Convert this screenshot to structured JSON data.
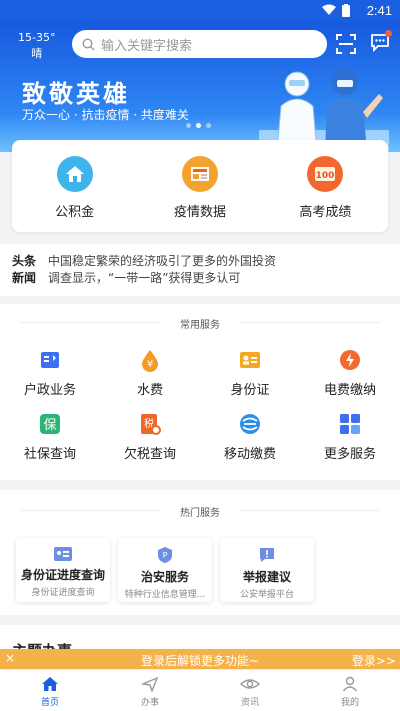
{
  "status_bar": {
    "time": "2:41"
  },
  "header": {
    "weather_temp": "15-35°",
    "weather_desc": "晴",
    "search_placeholder": "输入关键字搜索"
  },
  "banner": {
    "title": "致敬英雄",
    "subtitle": "万众一心 · 抗击疫情 · 共度难关"
  },
  "quick_entries": [
    {
      "label": "公积金",
      "icon": "house-icon",
      "color": "#3fb3ec"
    },
    {
      "label": "疫情数据",
      "icon": "newspaper-icon",
      "color": "#f3a22f"
    },
    {
      "label": "高考成绩",
      "icon": "score-100-icon",
      "color": "#f2672e"
    }
  ],
  "news": {
    "tag_line1": "头条",
    "tag_line2": "新闻",
    "items": [
      "中国稳定繁荣的经济吸引了更多的外国投资",
      "调查显示，“一带一路”获得更多认可"
    ]
  },
  "common_services": {
    "title": "常用服务",
    "items": [
      {
        "label": "户政业务",
        "icon": "household-icon",
        "color": "#3e6ff0"
      },
      {
        "label": "水费",
        "icon": "water-fee-icon",
        "color": "#f59a23"
      },
      {
        "label": "身份证",
        "icon": "id-card-icon",
        "color": "#f5a623"
      },
      {
        "label": "电费缴纳",
        "icon": "electricity-icon",
        "color": "#f26b2d"
      },
      {
        "label": "社保查询",
        "icon": "social-security-icon",
        "color": "#2bb673"
      },
      {
        "label": "欠税查询",
        "icon": "tax-query-icon",
        "color": "#f0672b"
      },
      {
        "label": "移动缴费",
        "icon": "china-mobile-icon",
        "color": "#2b8fe8"
      },
      {
        "label": "更多服务",
        "icon": "more-services-icon",
        "color": "#3e6ff0"
      }
    ]
  },
  "hot_services": {
    "title": "热门服务",
    "items": [
      {
        "title": "身份证进度查询",
        "subtitle": "身份证进度查询",
        "icon": "id-progress-icon"
      },
      {
        "title": "治安服务",
        "subtitle": "特种行业信息管理...",
        "icon": "police-badge-icon"
      },
      {
        "title": "举报建议",
        "subtitle": "公安举报平台",
        "icon": "report-icon"
      }
    ]
  },
  "partial_section_title": "主题办事",
  "login_bar": {
    "close": "×",
    "message": "登录后解锁更多功能~",
    "action": "登录>>"
  },
  "tabbar": [
    {
      "label": "首页",
      "icon": "home-icon",
      "active": true
    },
    {
      "label": "办事",
      "icon": "send-icon",
      "active": false
    },
    {
      "label": "资讯",
      "icon": "eye-icon",
      "active": false
    },
    {
      "label": "我的",
      "icon": "user-icon",
      "active": false
    }
  ]
}
